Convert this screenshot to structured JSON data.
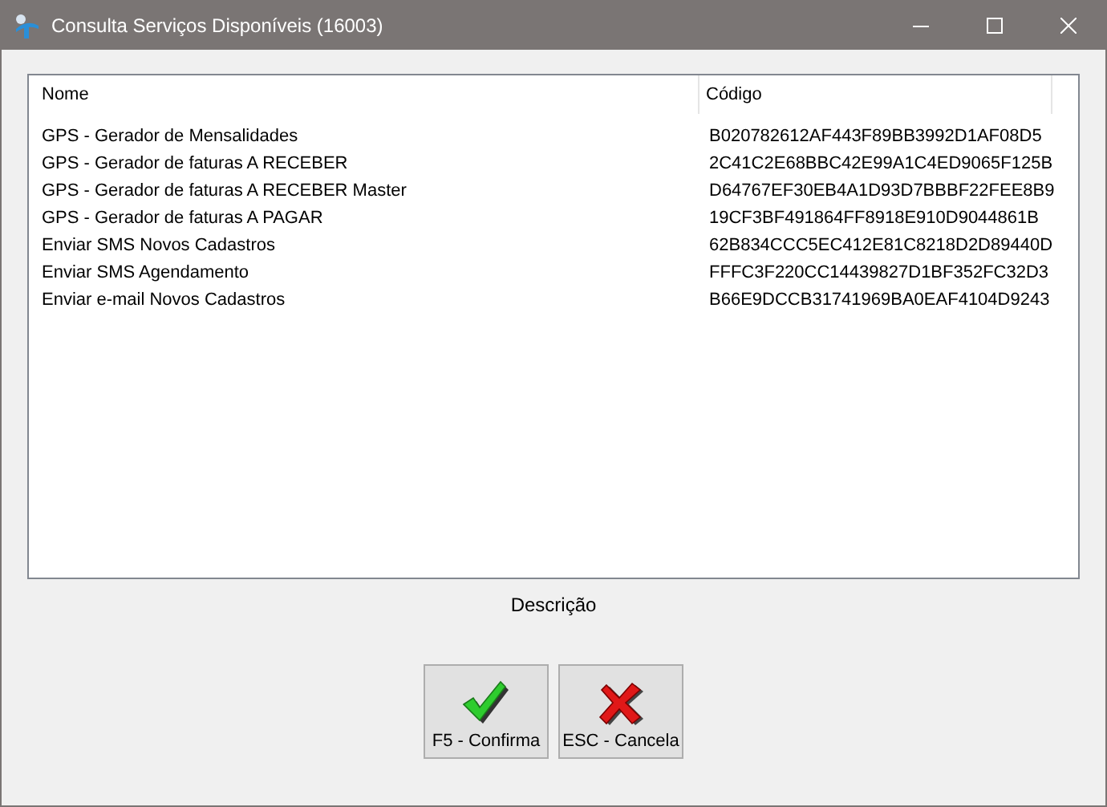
{
  "window": {
    "title": "Consulta Serviços Disponíveis (16003)"
  },
  "table": {
    "columns": [
      "Nome",
      "Código"
    ],
    "rows": [
      [
        "GPS - Gerador de Mensalidades",
        "B020782612AF443F89BB3992D1AF08D5"
      ],
      [
        "GPS - Gerador de faturas A RECEBER",
        "2C41C2E68BBC42E99A1C4ED9065F125B"
      ],
      [
        "GPS - Gerador de faturas A RECEBER Master",
        "D64767EF30EB4A1D93D7BBBF22FEE8B9"
      ],
      [
        "GPS - Gerador de faturas A PAGAR",
        "19CF3BF491864FF8918E910D9044861B"
      ],
      [
        "Enviar SMS Novos Cadastros",
        "62B834CCC5EC412E81C8218D2D89440D"
      ],
      [
        "Enviar SMS Agendamento",
        "FFFC3F220CC14439827D1BF352FC32D3"
      ],
      [
        "Enviar e-mail Novos Cadastros",
        "B66E9DCCB31741969BA0EAF4104D9243"
      ]
    ]
  },
  "description_label": "Descrição",
  "buttons": [
    {
      "kind": "confirm",
      "label": "F5 - Confirma"
    },
    {
      "kind": "cancel",
      "label": "ESC - Cancela"
    }
  ]
}
